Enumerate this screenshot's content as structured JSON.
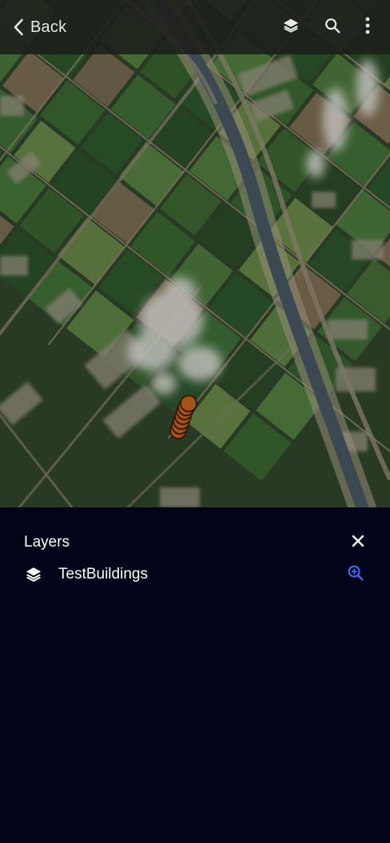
{
  "topbar": {
    "back_label": "Back",
    "actions": [
      {
        "icon": "layers-icon"
      },
      {
        "icon": "search-icon"
      },
      {
        "icon": "more-vertical-icon"
      }
    ]
  },
  "map": {
    "basemap": "satellite imagery",
    "feature_color": "#c8641e"
  },
  "layers_panel": {
    "title": "Layers",
    "close_icon": "close-icon",
    "layers": [
      {
        "name": "TestBuildings",
        "icon": "layers-icon",
        "action_icon": "zoom-in-icon"
      }
    ]
  },
  "colors": {
    "panel_background": "#02051a",
    "accent": "#3d6cff",
    "text": "#ffffff"
  }
}
